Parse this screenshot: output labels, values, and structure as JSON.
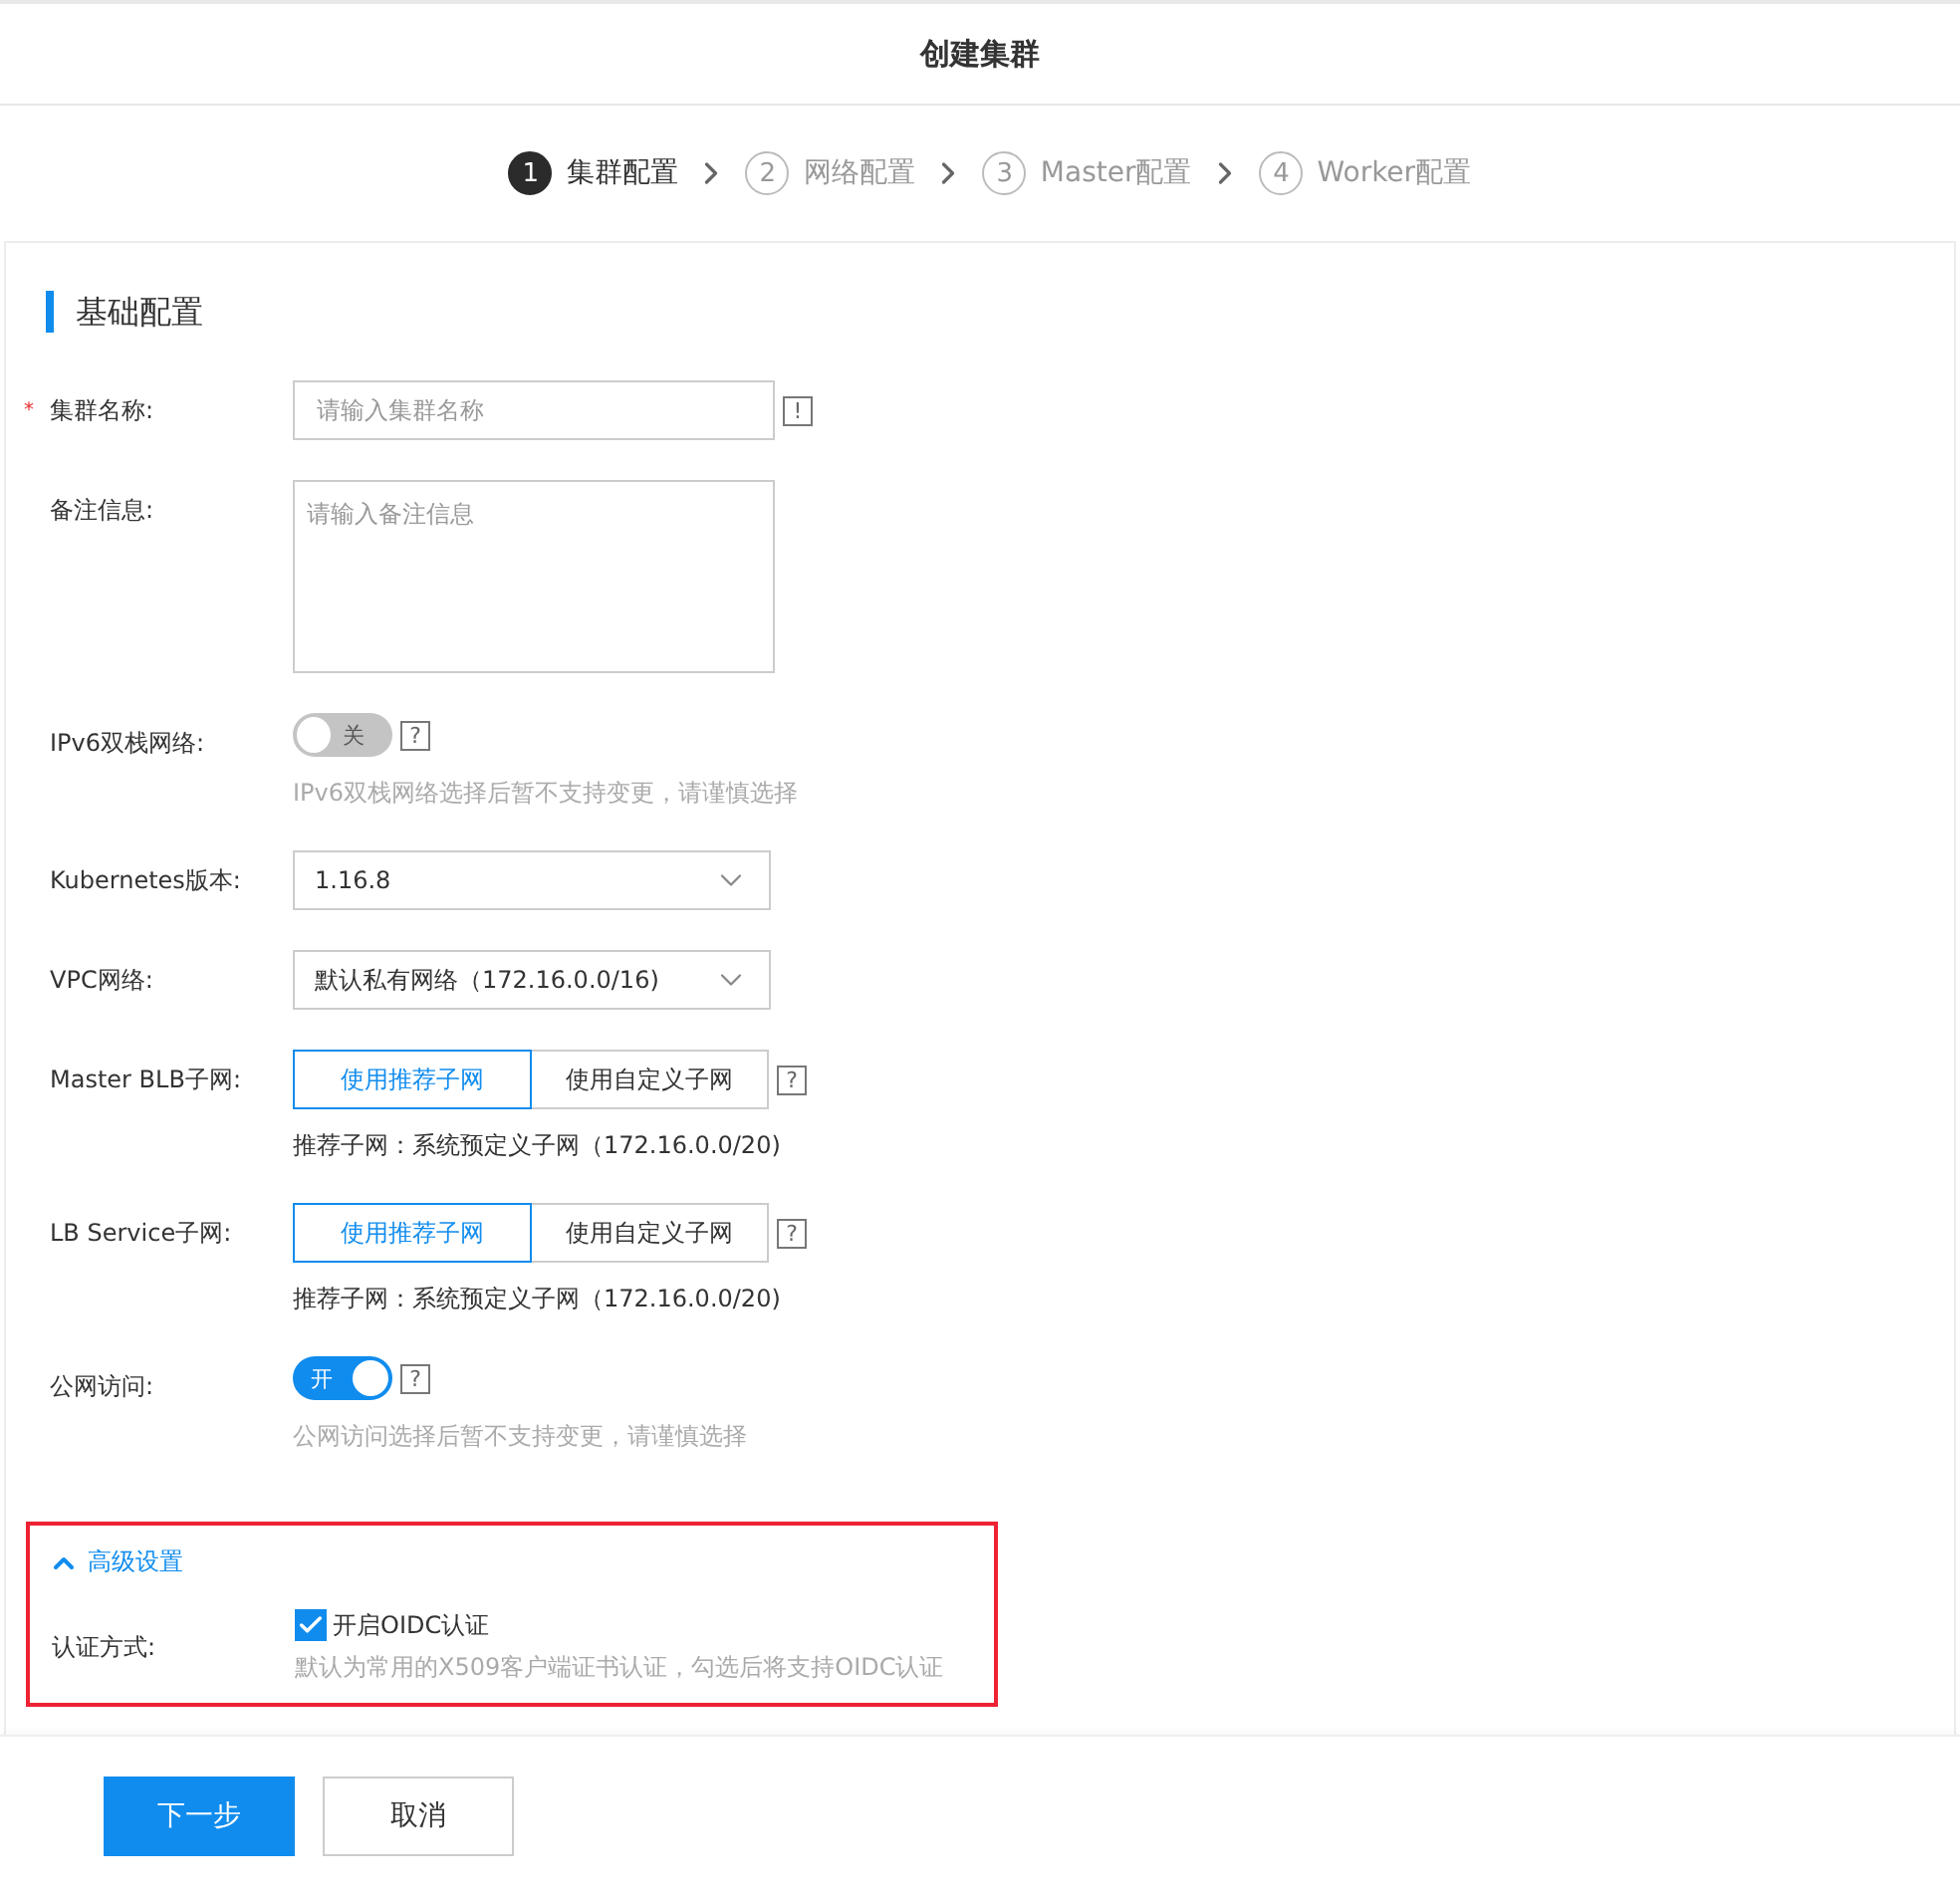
{
  "page_title": "创建集群",
  "steps": [
    {
      "number": "1",
      "label": "集群配置",
      "selected": true
    },
    {
      "number": "2",
      "label": "网络配置",
      "selected": false
    },
    {
      "number": "3",
      "label": "Master配置",
      "selected": false
    },
    {
      "number": "4",
      "label": "Worker配置",
      "selected": false
    }
  ],
  "section_title": "基础配置",
  "fields": [
    {
      "kind": "input",
      "label": "集群名称:",
      "required_mark": "*",
      "placeholder": "请输入集群名称",
      "help": "!"
    },
    {
      "kind": "textarea",
      "label": "备注信息:",
      "placeholder": "请输入备注信息"
    },
    {
      "kind": "switch",
      "label": "IPv6双栈网络:",
      "on": false,
      "switch_text": "关",
      "help": "?",
      "hint": "IPv6双栈网络选择后暂不支持变更，请谨慎选择"
    },
    {
      "kind": "select",
      "label": "Kubernetes版本:",
      "value": "1.16.8"
    },
    {
      "kind": "select",
      "label": "VPC网络:",
      "value": "默认私有网络（172.16.0.0/16)"
    },
    {
      "kind": "segmented",
      "label": "Master BLB子网:",
      "options": [
        {
          "label": "使用推荐子网",
          "selected": true
        },
        {
          "label": "使用自定义子网",
          "selected": false
        }
      ],
      "help": "?",
      "note": "推荐子网：系统预定义子网（172.16.0.0/20)"
    },
    {
      "kind": "segmented",
      "label": "LB Service子网:",
      "options": [
        {
          "label": "使用推荐子网",
          "selected": true
        },
        {
          "label": "使用自定义子网",
          "selected": false
        }
      ],
      "help": "?",
      "note": "推荐子网：系统预定义子网（172.16.0.0/20)"
    },
    {
      "kind": "switch",
      "label": "公网访问:",
      "on": true,
      "switch_text": "开",
      "help": "?",
      "hint": "公网访问选择后暂不支持变更，请谨慎选择"
    }
  ],
  "advanced": {
    "label": "高级设置",
    "expanded": true,
    "fields": [
      {
        "kind": "checkbox",
        "label": "认证方式:",
        "option": "开启OIDC认证",
        "checked": true,
        "hint": "默认为常用的X509客户端证书认证，勾选后将支持OIDC认证"
      }
    ]
  },
  "buttons": [
    {
      "label": "下一步",
      "kind": "primary"
    },
    {
      "label": "取消",
      "kind": "default"
    }
  ]
}
